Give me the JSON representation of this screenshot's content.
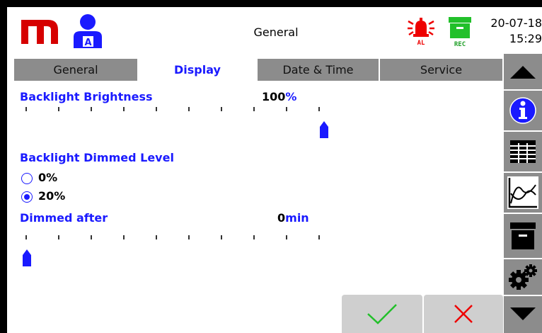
{
  "header": {
    "title": "General",
    "date": "20-07-18",
    "time": "15:29",
    "user_badge": "A",
    "alarm_label": "AL",
    "record_label": "REC",
    "brand_color": "#d60000",
    "accent_color": "#1a1aff"
  },
  "tabs": [
    {
      "label": "General",
      "active": false
    },
    {
      "label": "Display",
      "active": true
    },
    {
      "label": "Date & Time",
      "active": false
    },
    {
      "label": "Service",
      "active": false
    }
  ],
  "sidebar": {
    "items": [
      "arrow-up-icon",
      "info-icon",
      "table-grid-icon",
      "trend-chart-icon",
      "archive-box-icon",
      "settings-gears-icon",
      "arrow-down-icon"
    ]
  },
  "settings": {
    "brightness": {
      "label": "Backlight Brightness",
      "value": "100",
      "unit": "%",
      "level_fraction": 1.0
    },
    "dimmed_level": {
      "label": "Backlight Dimmed Level",
      "options": [
        {
          "label": "0%",
          "selected": false
        },
        {
          "label": "20%",
          "selected": true
        }
      ]
    },
    "dimmed_after": {
      "label": "Dimmed after",
      "value": "0",
      "unit": "min",
      "level_fraction": 0.0
    }
  },
  "footer": {
    "confirm_icon": "checkmark-icon",
    "cancel_icon": "cross-icon"
  }
}
